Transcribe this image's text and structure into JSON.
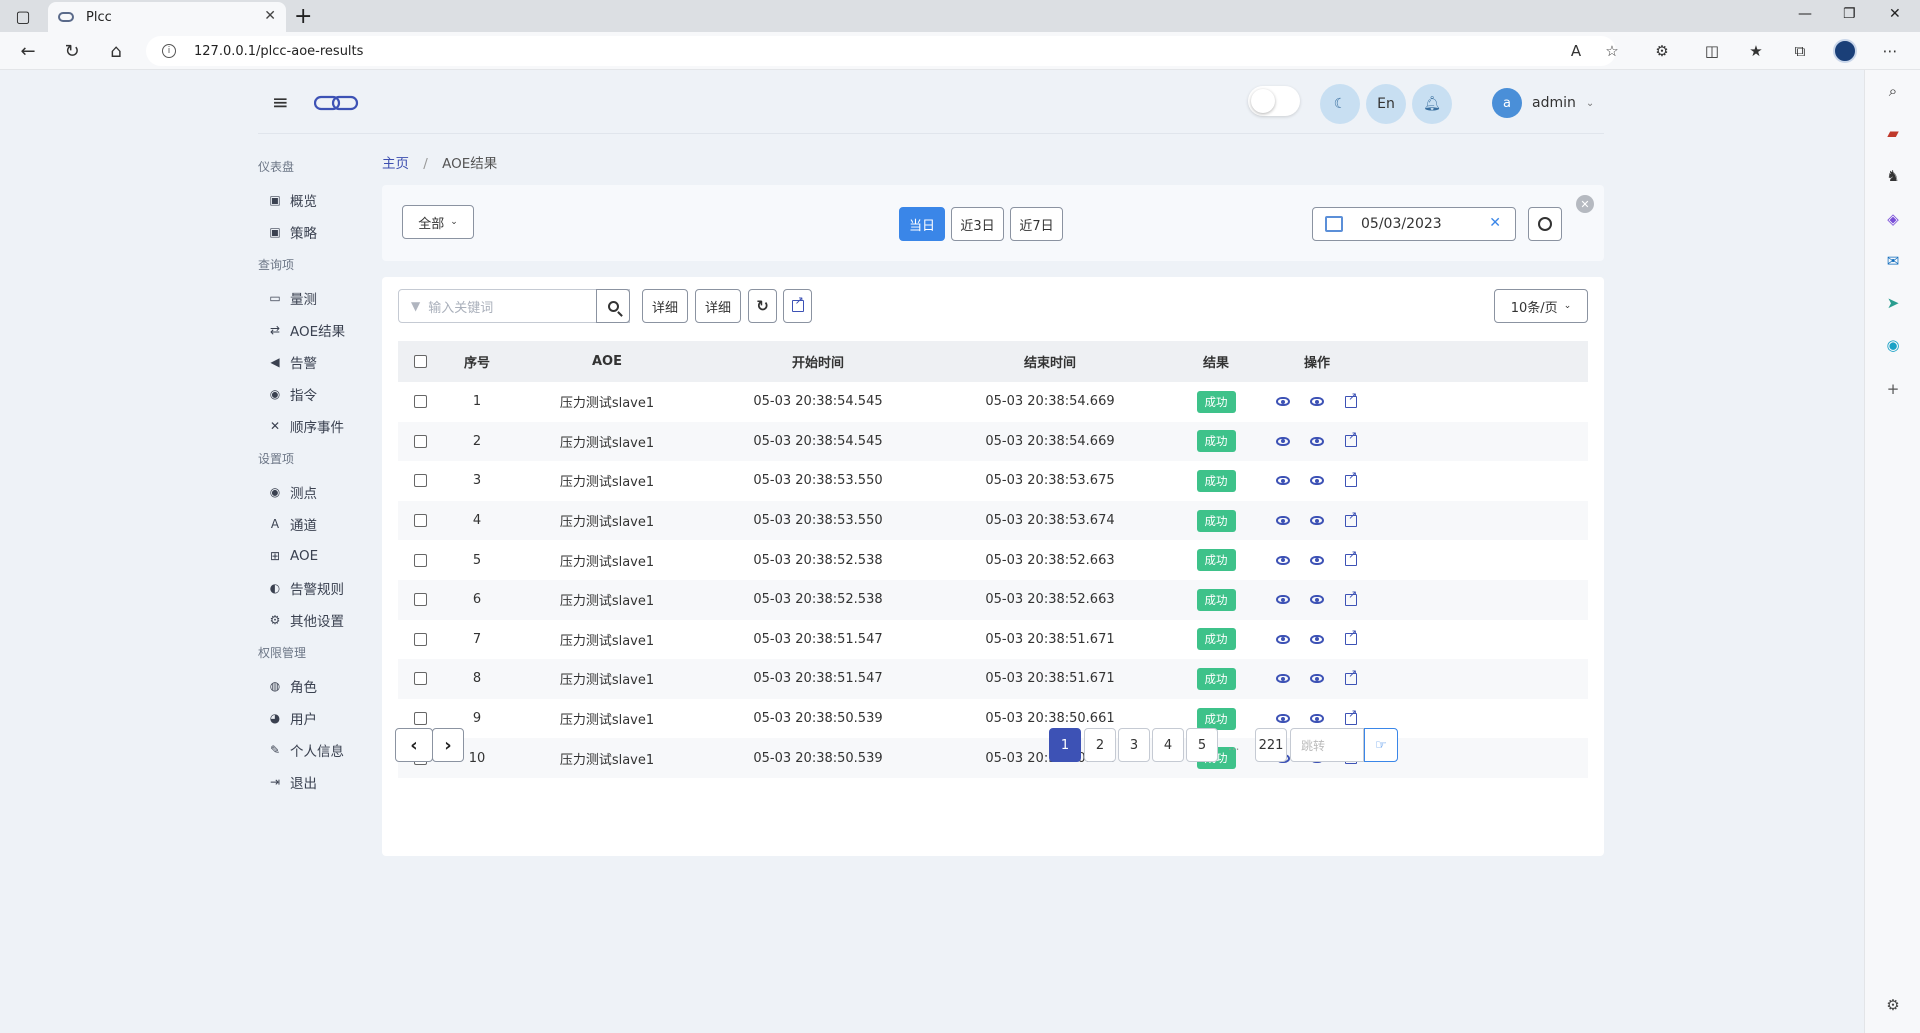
{
  "browser": {
    "tab_title": "Plcc",
    "url": "127.0.0.1/plcc-aoe-results"
  },
  "header": {
    "lang_button": "En",
    "user_initial": "a",
    "username": "admin"
  },
  "menu": {
    "groups": [
      {
        "label": "仪表盘",
        "items": [
          {
            "label": "概览",
            "icon": "▣"
          },
          {
            "label": "策略",
            "icon": "▣"
          }
        ]
      },
      {
        "label": "查询项",
        "items": [
          {
            "label": "量测",
            "icon": "▭"
          },
          {
            "label": "AOE结果",
            "icon": "⇄"
          },
          {
            "label": "告警",
            "icon": "◀"
          },
          {
            "label": "指令",
            "icon": "◉"
          },
          {
            "label": "顺序事件",
            "icon": "✕"
          }
        ]
      },
      {
        "label": "设置项",
        "items": [
          {
            "label": "测点",
            "icon": "◉"
          },
          {
            "label": "通道",
            "icon": "A"
          },
          {
            "label": "AOE",
            "icon": "⊞"
          },
          {
            "label": "告警规则",
            "icon": "◐"
          },
          {
            "label": "其他设置",
            "icon": "⚙"
          }
        ]
      },
      {
        "label": "权限管理",
        "items": [
          {
            "label": "角色",
            "icon": "◍"
          },
          {
            "label": "用户",
            "icon": "◕"
          },
          {
            "label": "个人信息",
            "icon": "✎"
          },
          {
            "label": "退出",
            "icon": "⇥"
          }
        ]
      }
    ]
  },
  "breadcrumb": {
    "home": "主页",
    "sep": "/",
    "current": "AOE结果"
  },
  "filter": {
    "scope": "全部",
    "today": "当日",
    "last3": "近3日",
    "last7": "近7日",
    "date": "05/03/2023"
  },
  "toolbar": {
    "search_placeholder": "输入关键词",
    "detail1": "详细",
    "detail2": "详细",
    "page_size": "10条/页"
  },
  "table": {
    "headers": {
      "seq": "序号",
      "aoe": "AOE",
      "start": "开始时间",
      "end": "结束时间",
      "result": "结果",
      "ops": "操作"
    },
    "rows": [
      {
        "seq": "1",
        "aoe": "压力测试slave1",
        "start": "05-03 20:38:54.545",
        "end": "05-03 20:38:54.669",
        "result": "成功"
      },
      {
        "seq": "2",
        "aoe": "压力测试slave1",
        "start": "05-03 20:38:54.545",
        "end": "05-03 20:38:54.669",
        "result": "成功"
      },
      {
        "seq": "3",
        "aoe": "压力测试slave1",
        "start": "05-03 20:38:53.550",
        "end": "05-03 20:38:53.675",
        "result": "成功"
      },
      {
        "seq": "4",
        "aoe": "压力测试slave1",
        "start": "05-03 20:38:53.550",
        "end": "05-03 20:38:53.674",
        "result": "成功"
      },
      {
        "seq": "5",
        "aoe": "压力测试slave1",
        "start": "05-03 20:38:52.538",
        "end": "05-03 20:38:52.663",
        "result": "成功"
      },
      {
        "seq": "6",
        "aoe": "压力测试slave1",
        "start": "05-03 20:38:52.538",
        "end": "05-03 20:38:52.663",
        "result": "成功"
      },
      {
        "seq": "7",
        "aoe": "压力测试slave1",
        "start": "05-03 20:38:51.547",
        "end": "05-03 20:38:51.671",
        "result": "成功"
      },
      {
        "seq": "8",
        "aoe": "压力测试slave1",
        "start": "05-03 20:38:51.547",
        "end": "05-03 20:38:51.671",
        "result": "成功"
      },
      {
        "seq": "9",
        "aoe": "压力测试slave1",
        "start": "05-03 20:38:50.539",
        "end": "05-03 20:38:50.661",
        "result": "成功"
      },
      {
        "seq": "10",
        "aoe": "压力测试slave1",
        "start": "05-03 20:38:50.539",
        "end": "05-03 20:38:50.662",
        "result": "成功"
      }
    ]
  },
  "pagination": {
    "pages": [
      "1",
      "2",
      "3",
      "4",
      "5"
    ],
    "active": "1",
    "ellipsis": "...",
    "last": "221",
    "jump_placeholder": "跳转"
  },
  "colors": {
    "primary": "#3a86e8",
    "accent": "#3d52b5",
    "success": "#3ec28a"
  }
}
